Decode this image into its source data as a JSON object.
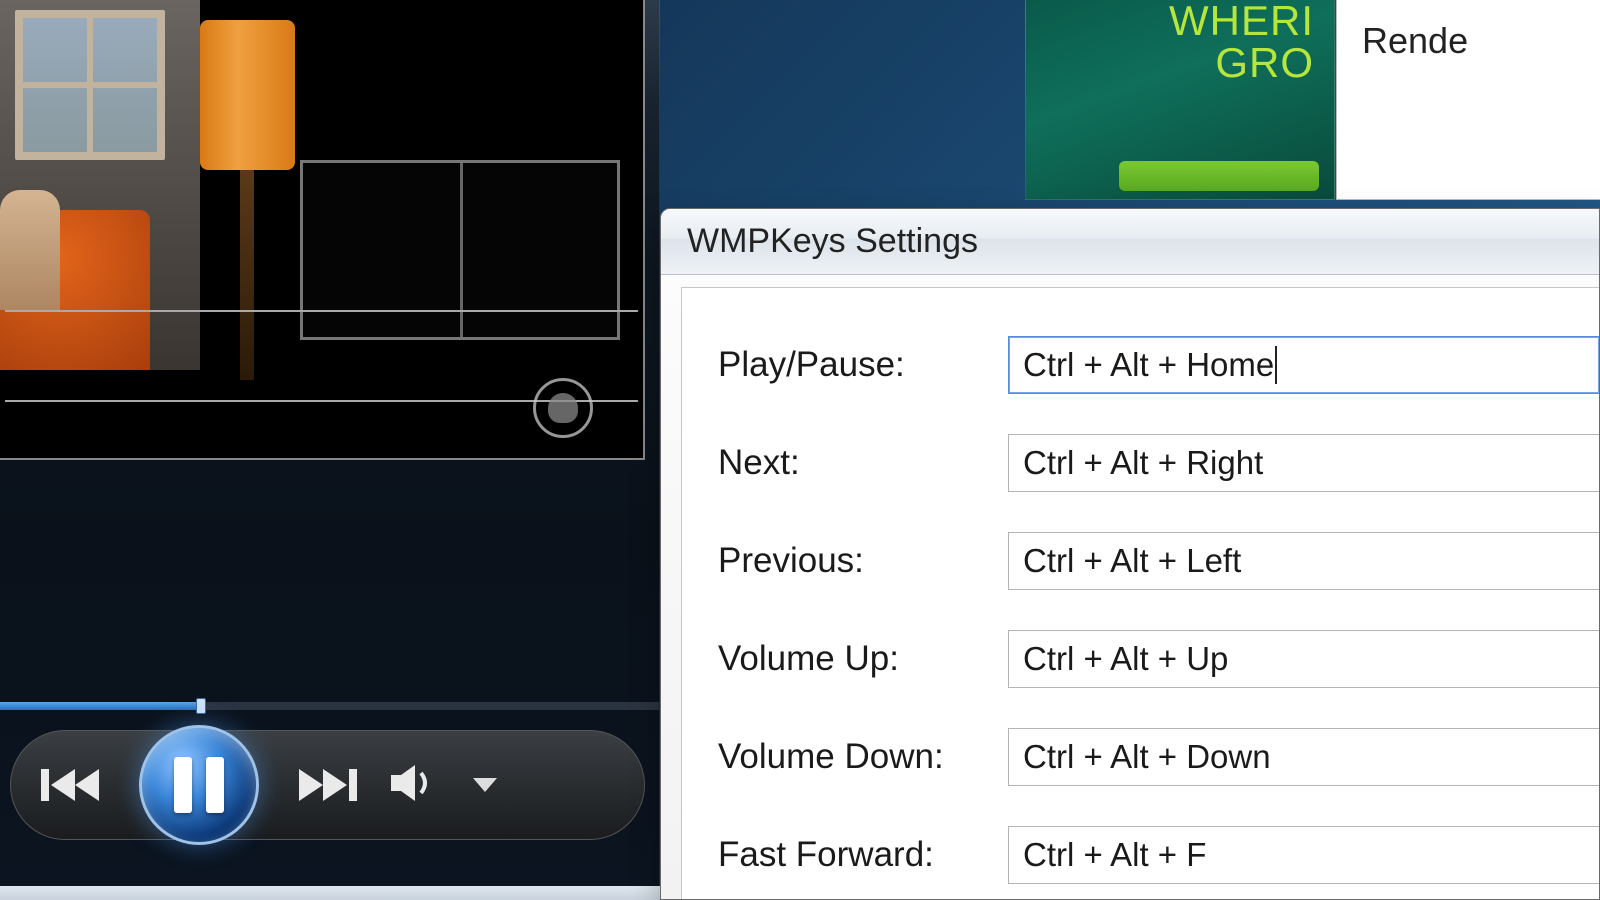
{
  "green_panel": {
    "line1": "WHERI",
    "line2": "GRO"
  },
  "white_fragment": {
    "line1": "Rende"
  },
  "dialog": {
    "title": "WMPKeys Settings",
    "rows": [
      {
        "label": "Play/Pause:",
        "value": "Ctrl + Alt + Home",
        "active": true
      },
      {
        "label": "Next:",
        "value": "Ctrl + Alt + Right",
        "active": false
      },
      {
        "label": "Previous:",
        "value": "Ctrl + Alt + Left",
        "active": false
      },
      {
        "label": "Volume Up:",
        "value": "Ctrl + Alt + Up",
        "active": false
      },
      {
        "label": "Volume Down:",
        "value": "Ctrl + Alt + Down",
        "active": false
      },
      {
        "label": "Fast Forward:",
        "value": "Ctrl + Alt + F",
        "active": false
      }
    ]
  },
  "player": {
    "state": "playing",
    "progress_pct": 30
  }
}
